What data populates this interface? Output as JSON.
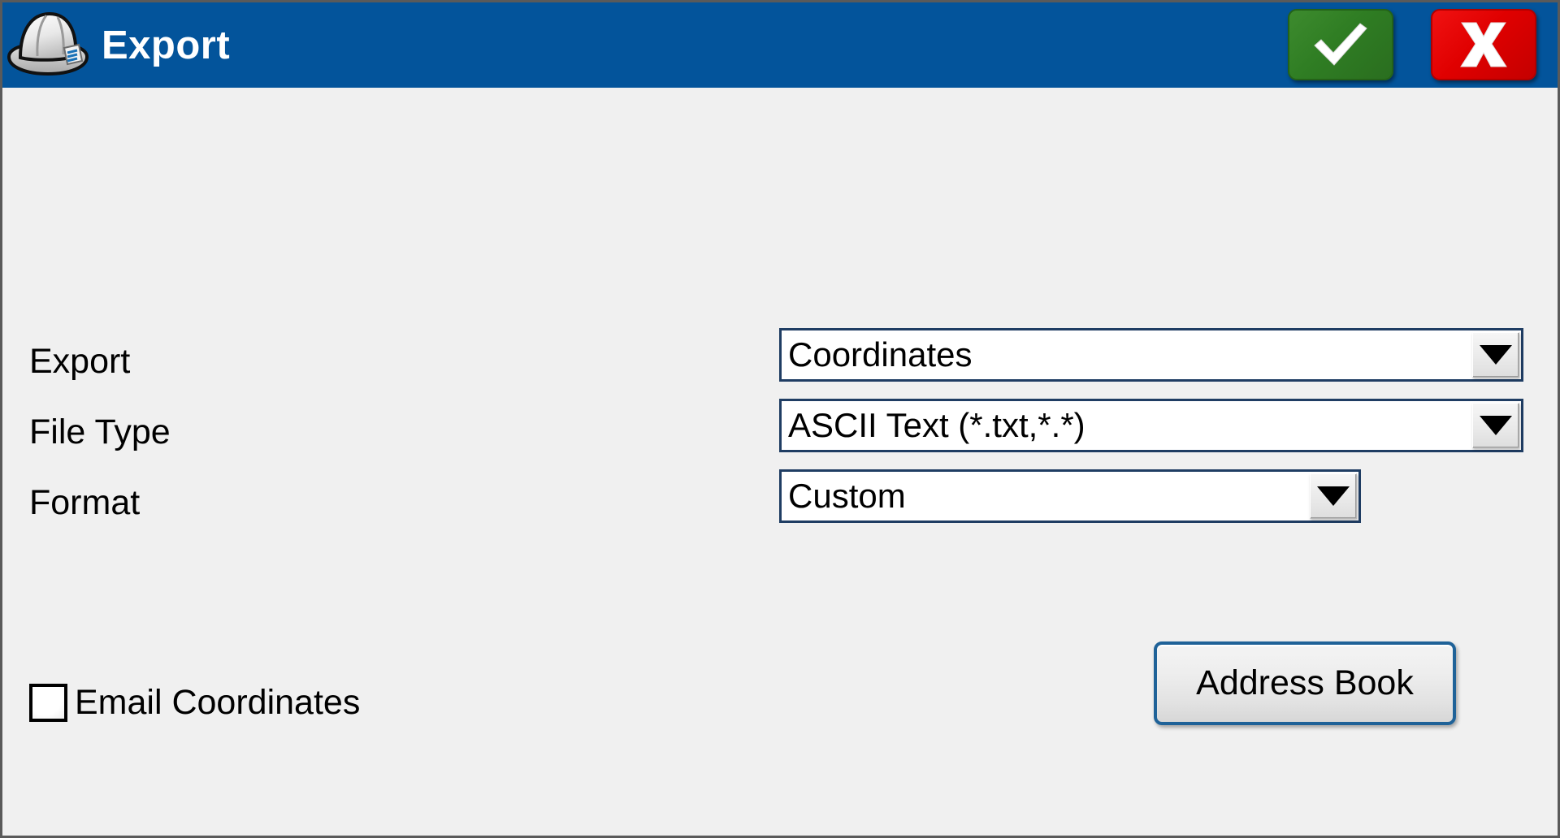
{
  "window": {
    "title": "Export",
    "icon": "hard-hat-icon",
    "titlebar_color": "#03549B",
    "body_color": "#F0F0F0"
  },
  "titlebar": {
    "accept_label": "✓",
    "accept_icon": "check-icon",
    "accept_color": "#2F7D23",
    "cancel_label": "X",
    "cancel_icon": "x-icon",
    "cancel_color": "#E00000"
  },
  "form": {
    "fields": [
      {
        "label": "Export",
        "value": "Coordinates"
      },
      {
        "label": "File Type",
        "value": "ASCII Text (*.txt,*.*)"
      },
      {
        "label": "Format",
        "value": "Custom"
      }
    ]
  },
  "email": {
    "checkbox_label": "Email Coordinates",
    "checked": false
  },
  "actions": {
    "address_book_label": "Address Book"
  }
}
